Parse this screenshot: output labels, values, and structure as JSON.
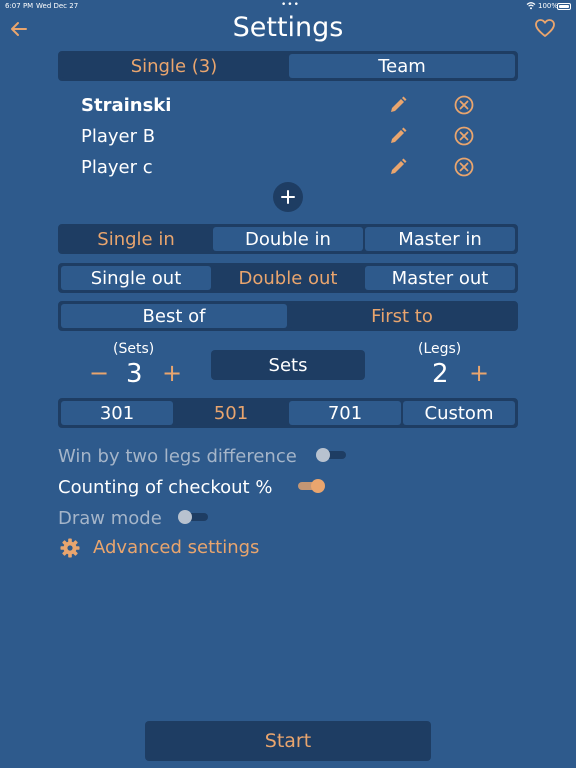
{
  "status_bar": {
    "time": "6:07 PM",
    "date": "Wed Dec 27",
    "battery": "100%"
  },
  "header": {
    "title": "Settings",
    "back_icon": "arrow-left-icon",
    "favorite_icon": "heart-icon"
  },
  "mode_tabs": {
    "options": [
      "Single (3)",
      "Team"
    ],
    "selected": "Single (3)"
  },
  "players": [
    {
      "name": "Strainski",
      "bold": true
    },
    {
      "name": "Player B",
      "bold": false
    },
    {
      "name": "Player c",
      "bold": false
    }
  ],
  "in_mode": {
    "options": [
      "Single in",
      "Double in",
      "Master in"
    ],
    "selected": "Single in"
  },
  "out_mode": {
    "options": [
      "Single out",
      "Double out",
      "Master out"
    ],
    "selected": "Double out"
  },
  "match_format": {
    "options": [
      "Best of",
      "First to"
    ],
    "selected": "First to"
  },
  "sets_counter": {
    "label": "(Sets)",
    "value": "3",
    "minus": "−",
    "plus": "+"
  },
  "legs_counter": {
    "label": "(Legs)",
    "value": "2",
    "plus": "+"
  },
  "unit_button": {
    "label": "Sets"
  },
  "score_options": {
    "options": [
      "301",
      "501",
      "701",
      "Custom"
    ],
    "selected": "501"
  },
  "toggles": [
    {
      "label": "Win by two legs difference",
      "on": false
    },
    {
      "label": "Counting of checkout %",
      "on": true
    },
    {
      "label": "Draw mode",
      "on": false
    }
  ],
  "advanced": {
    "label": "Advanced settings",
    "icon": "gear-icon"
  },
  "start_button": {
    "label": "Start"
  },
  "colors": {
    "background": "#2e5a8c",
    "dark": "#1e3d63",
    "accent": "#e9a56e"
  }
}
